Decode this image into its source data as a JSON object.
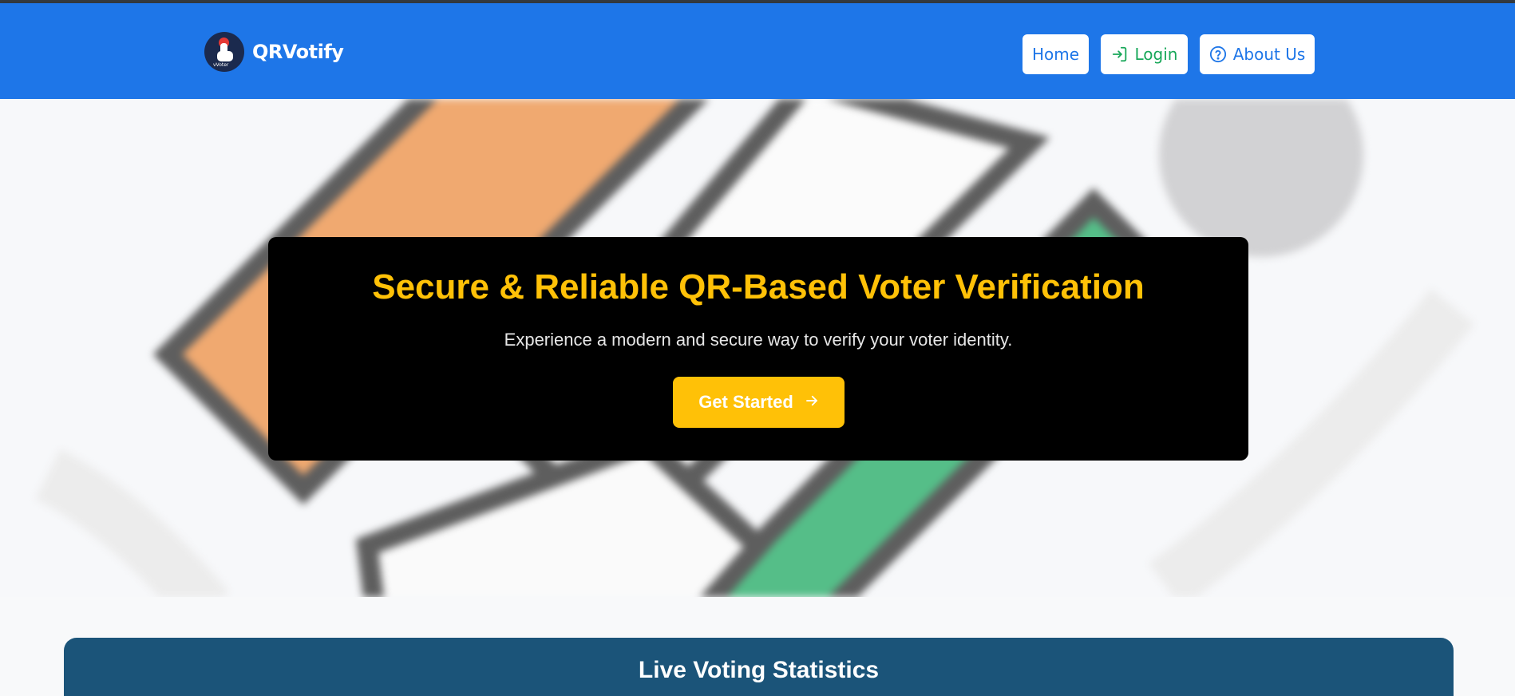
{
  "navbar": {
    "brand": "QRVotify",
    "logo_tag": "vVoter",
    "logo_icon": "touch-vote-logo",
    "links": [
      {
        "label": "Home",
        "icon": ""
      },
      {
        "label": "Login",
        "icon": "login-icon"
      },
      {
        "label": "About Us",
        "icon": "question-circle-icon"
      }
    ]
  },
  "hero": {
    "background_watermark": "Election Commission of India emblem",
    "title": "Secure & Reliable QR-Based Voter Verification",
    "subtitle": "Experience a modern and secure way to verify your voter identity.",
    "cta_label": "Get Started",
    "cta_icon": "arrow-right-icon"
  },
  "stats": {
    "title": "Live Voting Statistics"
  },
  "colors": {
    "navbar": "#1e76e8",
    "accent": "#ffc107",
    "login": "#19a85a",
    "stats_bg": "#1b5479",
    "card_bg": "#000000"
  }
}
